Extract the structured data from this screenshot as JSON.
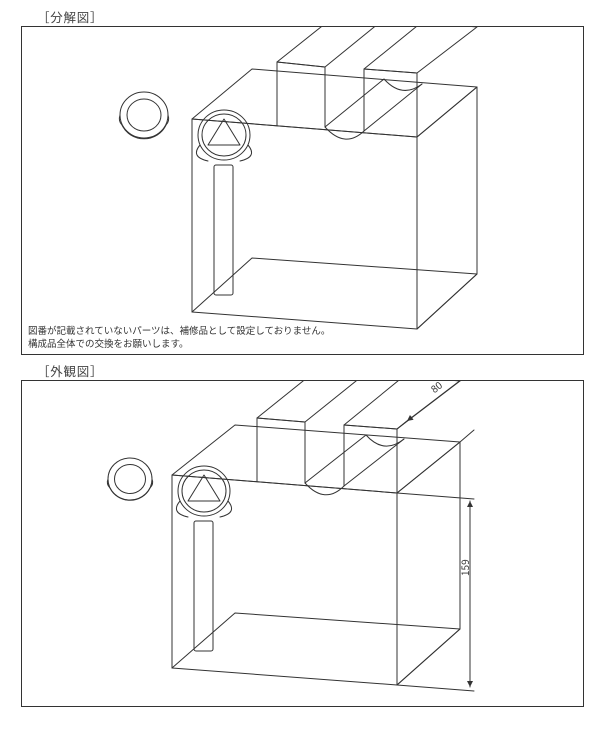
{
  "titles": {
    "exploded": "［分解図］",
    "exterior": "［外観図］"
  },
  "note": {
    "line1": "図番が記載されていないパーツは、補修品として設定しておりません。",
    "line2": "構成品全体での交換をお願いします。"
  },
  "dimensions": {
    "height": "159",
    "depth": "80"
  }
}
